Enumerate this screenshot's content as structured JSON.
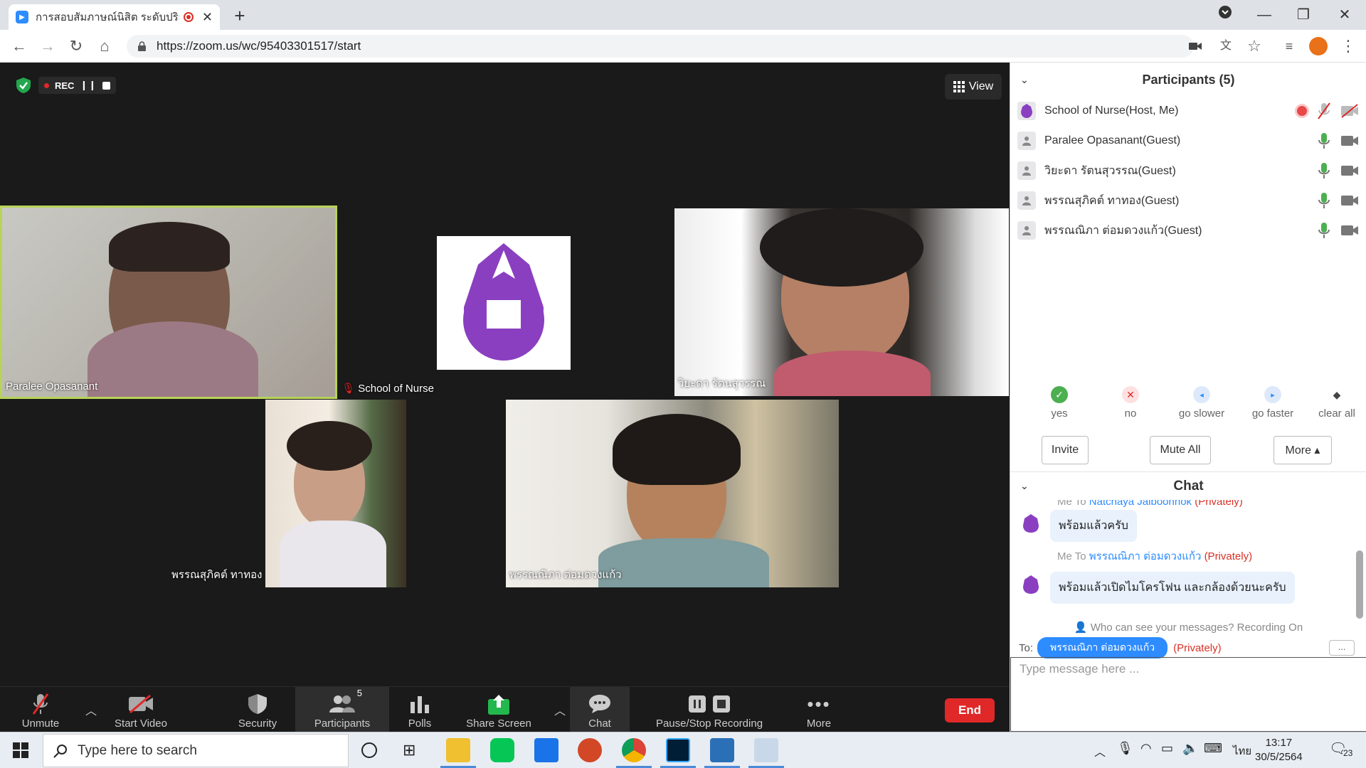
{
  "browser": {
    "tab_title": "การสอบสัมภาษณ์นิสิต ระดับปริญ",
    "url": "https://zoom.us/wc/95403301517/start"
  },
  "meeting": {
    "rec_label": "REC",
    "view_label": "View",
    "tiles": [
      {
        "name": "Paralee Opasanant",
        "active": true
      },
      {
        "name": "School of Nurse",
        "muted": true
      },
      {
        "name": "วิยะดา รัตนสุวรรณ"
      },
      {
        "name": "พรรณสุภิคต์ ทาทอง"
      },
      {
        "name": "พรรณณิภา ต่อมดวงแก้ว"
      }
    ]
  },
  "toolbar": {
    "unmute": "Unmute",
    "start_video": "Start Video",
    "security": "Security",
    "participants": "Participants",
    "participants_count": "5",
    "polls": "Polls",
    "share_screen": "Share Screen",
    "chat": "Chat",
    "recording": "Pause/Stop Recording",
    "more": "More",
    "end": "End"
  },
  "participants_panel": {
    "title": "Participants (5)",
    "list": [
      {
        "name": "School of Nurse(Host, Me)",
        "mic": "muted",
        "cam": "off",
        "recording": true
      },
      {
        "name": "Paralee Opasanant(Guest)",
        "mic": "on",
        "cam": "on"
      },
      {
        "name": "วิยะดา รัตนสุวรรณ(Guest)",
        "mic": "on",
        "cam": "on"
      },
      {
        "name": "พรรณสุภิคต์ ทาทอง(Guest)",
        "mic": "on",
        "cam": "on"
      },
      {
        "name": "พรรณณิภา ต่อมดวงแก้ว(Guest)",
        "mic": "on",
        "cam": "on"
      }
    ],
    "reactions": [
      "yes",
      "no",
      "go slower",
      "go faster",
      "clear all"
    ],
    "invite": "Invite",
    "mute_all": "Mute All",
    "more": "More ▴"
  },
  "chat": {
    "title": "Chat",
    "messages": [
      {
        "from": "Me",
        "to_word": "To",
        "to": "Natchaya Jaiboonhok",
        "privacy": "(Privately)",
        "text": "พร้อมแล้วครับ"
      },
      {
        "from": "Me",
        "to_word": "To",
        "to": "พรรณณิภา ต่อมดวงแก้ว",
        "privacy": "(Privately)",
        "text": "พร้อมแล้วเปิดไมโครโฟน และกล้องด้วยนะครับ"
      }
    ],
    "who_can_see": "Who can see your messages? Recording On",
    "to_label": "To:",
    "recipient": "พรรณณิภา ต่อมดวงแก้ว",
    "recipient_privacy": "(Privately)",
    "more": "...",
    "placeholder": "Type message here ..."
  },
  "taskbar": {
    "search_placeholder": "Type here to search",
    "lang": "ไทย",
    "time": "13:17",
    "date": "30/5/2564",
    "notif_count": "23"
  }
}
